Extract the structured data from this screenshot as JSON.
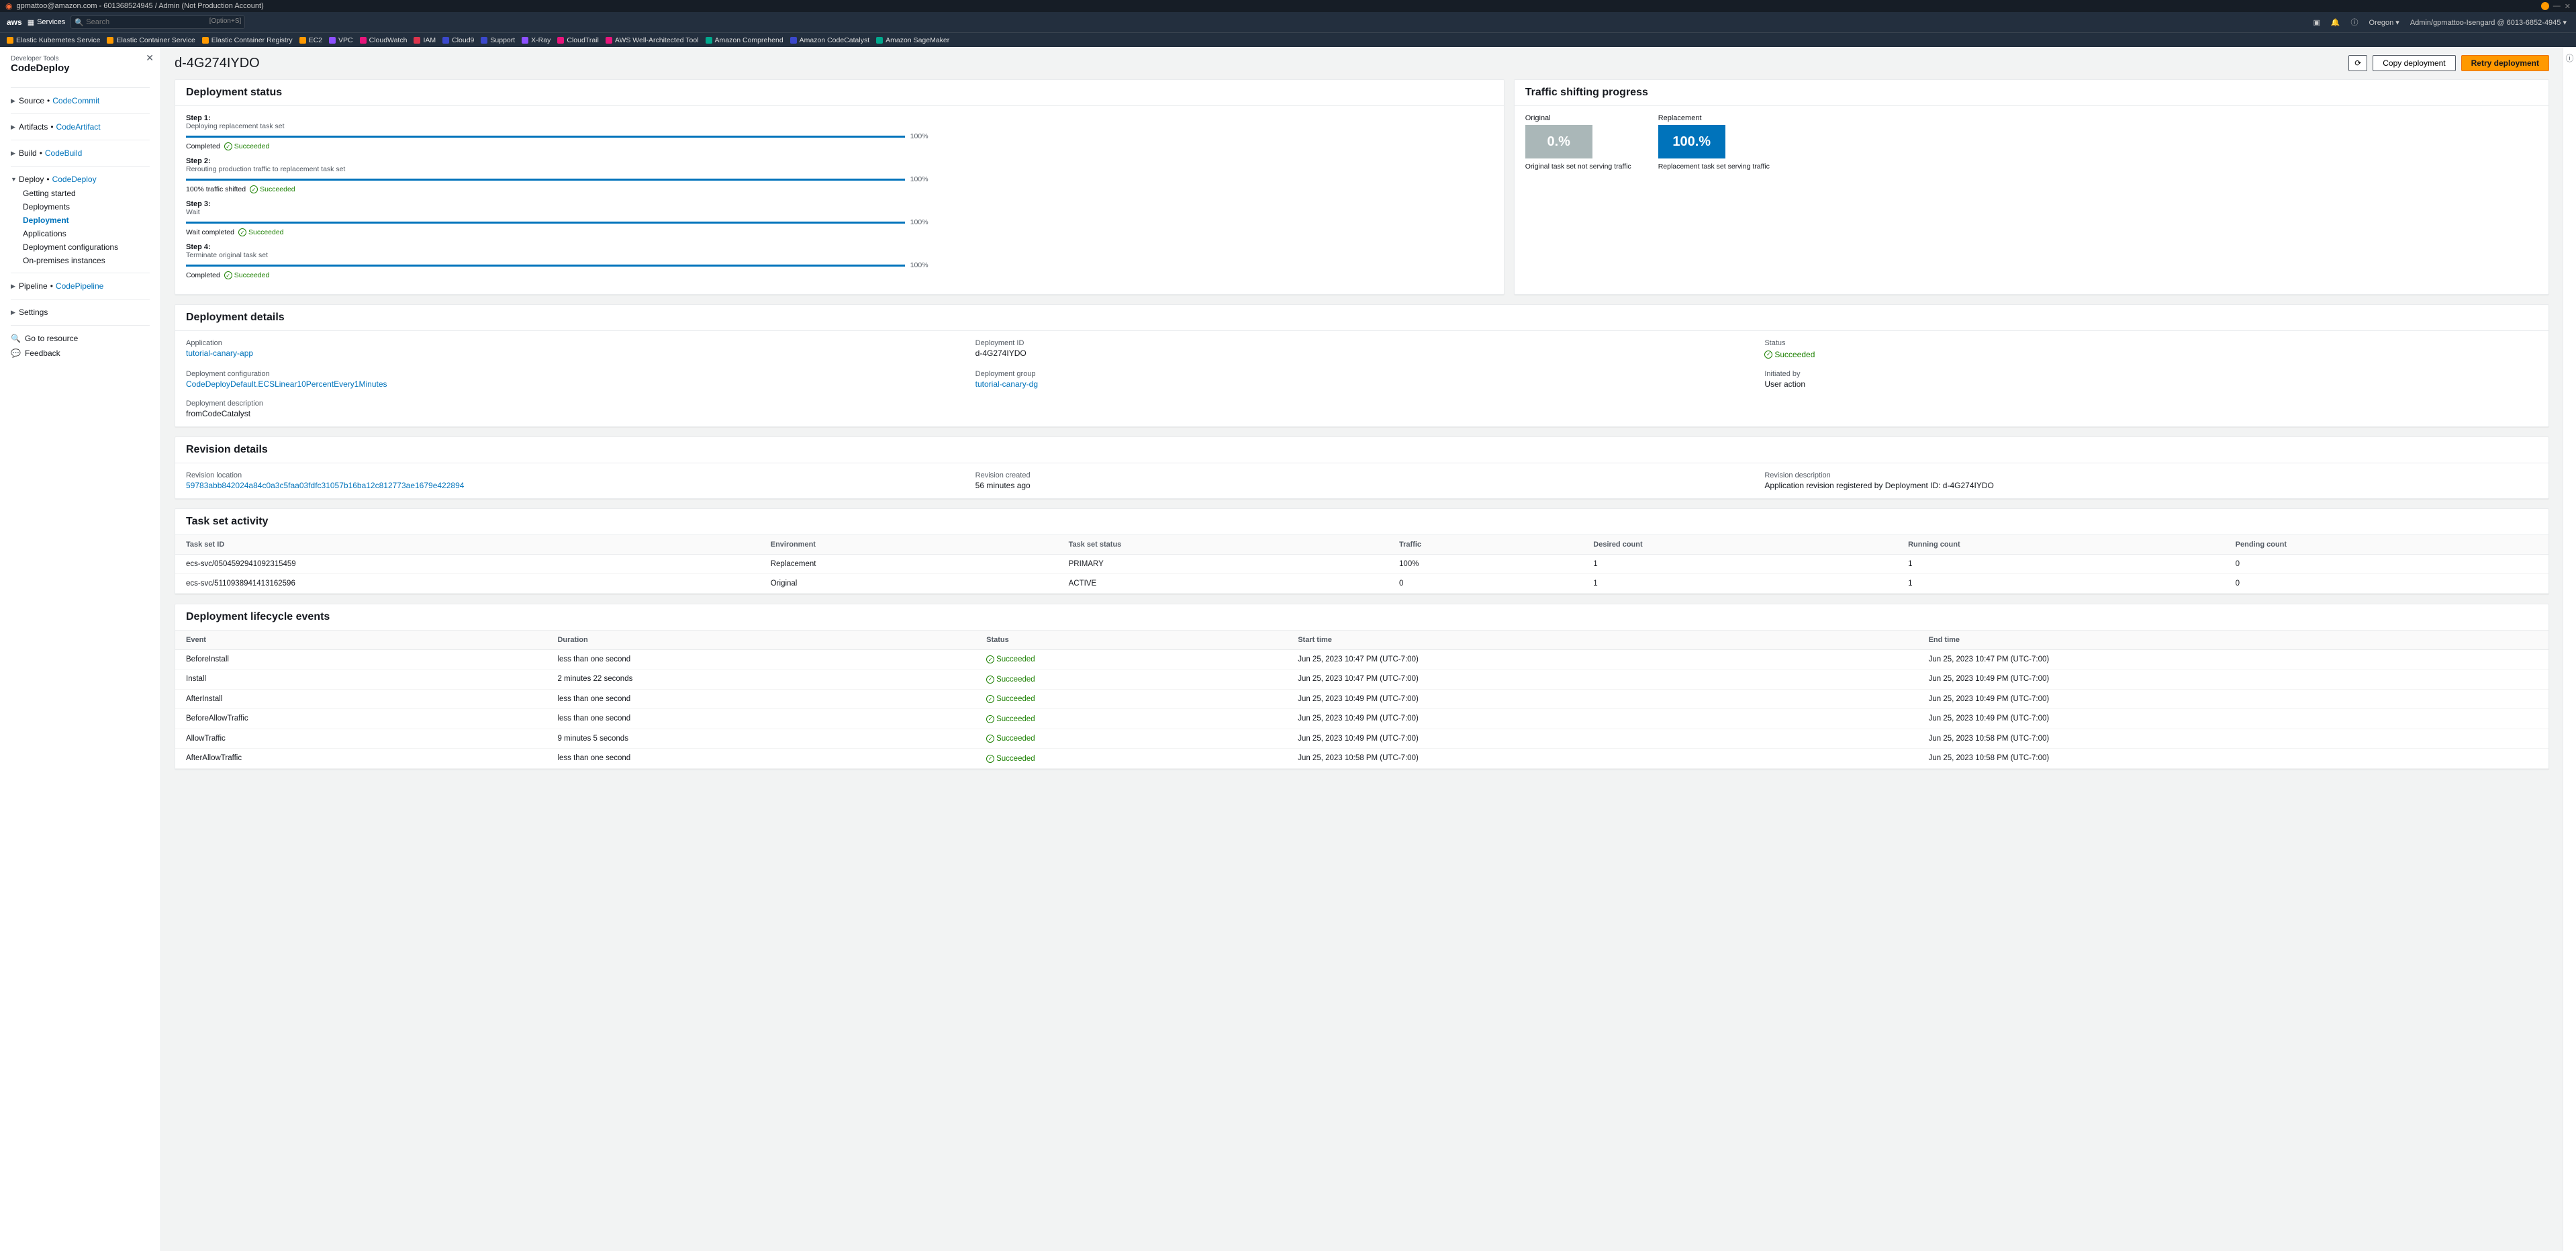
{
  "topbar": {
    "account": "gpmattoo@amazon.com - 601368524945 / Admin (Not Production Account)"
  },
  "navbar": {
    "services": "Services",
    "search_placeholder": "Search",
    "search_shortcut": "[Option+S]",
    "region": "Oregon",
    "user": "Admin/gpmattoo-Isengard @ 6013-6852-4945"
  },
  "favorites": [
    {
      "label": "Elastic Kubernetes Service",
      "color": "#ff9900"
    },
    {
      "label": "Elastic Container Service",
      "color": "#ff9900"
    },
    {
      "label": "Elastic Container Registry",
      "color": "#ff9900"
    },
    {
      "label": "EC2",
      "color": "#ff9900"
    },
    {
      "label": "VPC",
      "color": "#8c4fff"
    },
    {
      "label": "CloudWatch",
      "color": "#e7157b"
    },
    {
      "label": "IAM",
      "color": "#dd344c"
    },
    {
      "label": "Cloud9",
      "color": "#3b48cc"
    },
    {
      "label": "Support",
      "color": "#3b48cc"
    },
    {
      "label": "X-Ray",
      "color": "#8c4fff"
    },
    {
      "label": "CloudTrail",
      "color": "#e7157b"
    },
    {
      "label": "AWS Well-Architected Tool",
      "color": "#e7157b"
    },
    {
      "label": "Amazon Comprehend",
      "color": "#01a88d"
    },
    {
      "label": "Amazon CodeCatalyst",
      "color": "#3b48cc"
    },
    {
      "label": "Amazon SageMaker",
      "color": "#01a88d"
    }
  ],
  "sidebar": {
    "tool": "Developer Tools",
    "service": "CodeDeploy",
    "sections": {
      "source": "Source",
      "source_svc": "CodeCommit",
      "artifacts": "Artifacts",
      "artifacts_svc": "CodeArtifact",
      "build": "Build",
      "build_svc": "CodeBuild",
      "deploy": "Deploy",
      "deploy_svc": "CodeDeploy",
      "deploy_items": [
        "Getting started",
        "Deployments",
        "Deployment",
        "Applications",
        "Deployment configurations",
        "On-premises instances"
      ],
      "pipeline": "Pipeline",
      "pipeline_svc": "CodePipeline",
      "settings": "Settings"
    },
    "goto": "Go to resource",
    "feedback": "Feedback"
  },
  "page": {
    "title": "d-4G274IYDO",
    "copy_btn": "Copy deployment",
    "retry_btn": "Retry deployment"
  },
  "status": {
    "heading": "Deployment status",
    "steps": [
      {
        "title": "Step 1:",
        "desc": "Deploying replacement task set",
        "pct": "100%",
        "footL": "Completed",
        "footR": "Succeeded"
      },
      {
        "title": "Step 2:",
        "desc": "Rerouting production traffic to replacement task set",
        "pct": "100%",
        "footL": "100% traffic shifted",
        "footR": "Succeeded"
      },
      {
        "title": "Step 3:",
        "desc": "Wait",
        "pct": "100%",
        "footL": "Wait completed",
        "footR": "Succeeded"
      },
      {
        "title": "Step 4:",
        "desc": "Terminate original task set",
        "pct": "100%",
        "footL": "Completed",
        "footR": "Succeeded"
      }
    ]
  },
  "traffic": {
    "heading": "Traffic shifting progress",
    "orig_lbl": "Original",
    "orig_pct": "0.%",
    "orig_cap": "Original task set not serving traffic",
    "repl_lbl": "Replacement",
    "repl_pct": "100.%",
    "repl_cap": "Replacement task set serving traffic"
  },
  "details": {
    "heading": "Deployment details",
    "app_lbl": "Application",
    "app_val": "tutorial-canary-app",
    "did_lbl": "Deployment ID",
    "did_val": "d-4G274IYDO",
    "status_lbl": "Status",
    "status_val": "Succeeded",
    "cfg_lbl": "Deployment configuration",
    "cfg_val": "CodeDeployDefault.ECSLinear10PercentEvery1Minutes",
    "grp_lbl": "Deployment group",
    "grp_val": "tutorial-canary-dg",
    "init_lbl": "Initiated by",
    "init_val": "User action",
    "desc_lbl": "Deployment description",
    "desc_val": "fromCodeCatalyst"
  },
  "revision": {
    "heading": "Revision details",
    "loc_lbl": "Revision location",
    "loc_val": "59783abb842024a84c0a3c5faa03fdfc31057b16ba12c812773ae1679e422894",
    "created_lbl": "Revision created",
    "created_val": "56 minutes ago",
    "desc_lbl": "Revision description",
    "desc_val": "Application revision registered by Deployment ID: d-4G274IYDO"
  },
  "taskset": {
    "heading": "Task set activity",
    "cols": [
      "Task set ID",
      "Environment",
      "Task set status",
      "Traffic",
      "Desired count",
      "Running count",
      "Pending count"
    ],
    "rows": [
      [
        "ecs-svc/0504592941092315459",
        "Replacement",
        "PRIMARY",
        "100%",
        "1",
        "1",
        "0"
      ],
      [
        "ecs-svc/5110938941413162596",
        "Original",
        "ACTIVE",
        "0",
        "1",
        "1",
        "0"
      ]
    ]
  },
  "lifecycle": {
    "heading": "Deployment lifecycle events",
    "cols": [
      "Event",
      "Duration",
      "Status",
      "Start time",
      "End time"
    ],
    "rows": [
      [
        "BeforeInstall",
        "less than one second",
        "Succeeded",
        "Jun 25, 2023 10:47 PM (UTC-7:00)",
        "Jun 25, 2023 10:47 PM (UTC-7:00)"
      ],
      [
        "Install",
        "2 minutes 22 seconds",
        "Succeeded",
        "Jun 25, 2023 10:47 PM (UTC-7:00)",
        "Jun 25, 2023 10:49 PM (UTC-7:00)"
      ],
      [
        "AfterInstall",
        "less than one second",
        "Succeeded",
        "Jun 25, 2023 10:49 PM (UTC-7:00)",
        "Jun 25, 2023 10:49 PM (UTC-7:00)"
      ],
      [
        "BeforeAllowTraffic",
        "less than one second",
        "Succeeded",
        "Jun 25, 2023 10:49 PM (UTC-7:00)",
        "Jun 25, 2023 10:49 PM (UTC-7:00)"
      ],
      [
        "AllowTraffic",
        "9 minutes 5 seconds",
        "Succeeded",
        "Jun 25, 2023 10:49 PM (UTC-7:00)",
        "Jun 25, 2023 10:58 PM (UTC-7:00)"
      ],
      [
        "AfterAllowTraffic",
        "less than one second",
        "Succeeded",
        "Jun 25, 2023 10:58 PM (UTC-7:00)",
        "Jun 25, 2023 10:58 PM (UTC-7:00)"
      ]
    ]
  }
}
